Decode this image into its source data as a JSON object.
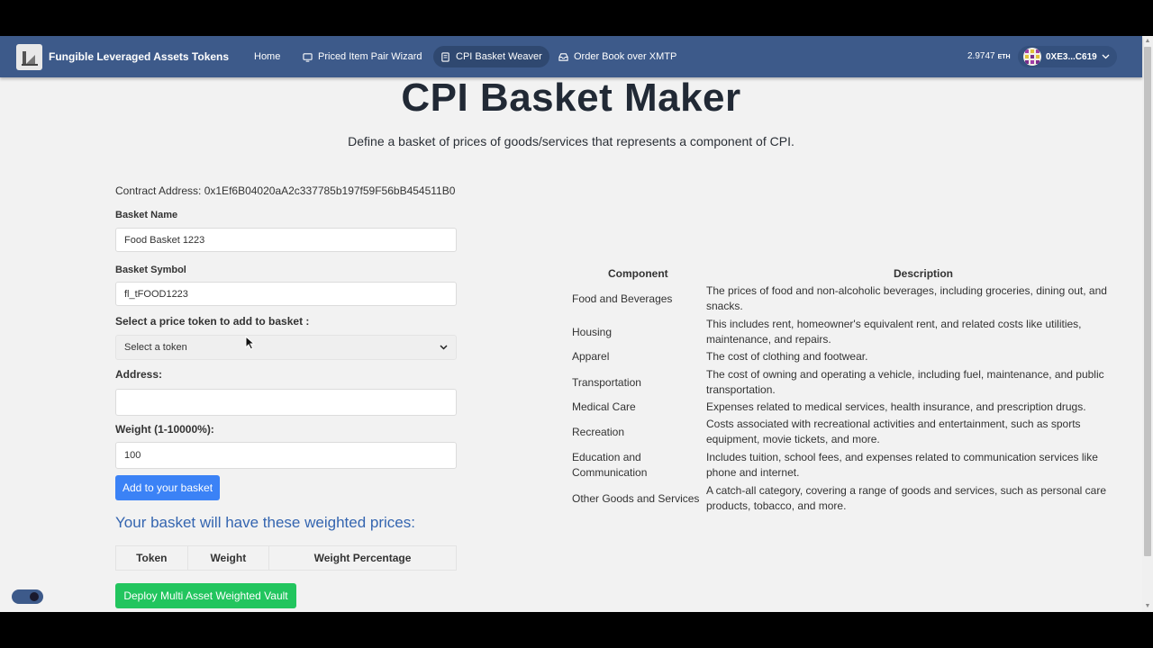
{
  "navbar": {
    "brand": "Fungible Leveraged Assets Tokens",
    "items": [
      {
        "label": "Home",
        "icon": "none"
      },
      {
        "label": "Priced Item Pair Wizard",
        "icon": "wizard-icon"
      },
      {
        "label": "CPI Basket Weaver",
        "icon": "document-icon",
        "active": true
      },
      {
        "label": "Order Book over XMTP",
        "icon": "inbox-icon"
      }
    ],
    "balance": "2.9747",
    "balance_unit": "ETH",
    "account": "0XE3...C619"
  },
  "page": {
    "title": "CPI Basket Maker",
    "subtitle": "Define a basket of prices of goods/services that represents a component of CPI.",
    "contract": "Contract Address: 0x1Ef6B04020aA2c337785b197f59F56bB454511B0"
  },
  "form": {
    "basket_name_label": "Basket Name",
    "basket_name_value": "Food Basket 1223",
    "basket_symbol_label": "Basket Symbol",
    "basket_symbol_value": "fl_tFOOD1223",
    "token_select_label": "Select a price token to add to basket :",
    "token_select_value": "Select a token",
    "address_label": "Address:",
    "address_value": "",
    "weight_label": "Weight (1-10000%):",
    "weight_value": "100",
    "add_button": "Add to your basket",
    "basket_heading": "Your basket will have these weighted prices:",
    "table_headers": [
      "Token",
      "Weight",
      "Weight Percentage"
    ],
    "deploy_button": "Deploy Multi Asset Weighted Vault"
  },
  "cpi": {
    "headers": {
      "component": "Component",
      "description": "Description"
    },
    "rows": [
      {
        "component": "Food and Beverages",
        "description": "The prices of food and non-alcoholic beverages, including groceries, dining out, and snacks."
      },
      {
        "component": "Housing",
        "description": "This includes rent, homeowner's equivalent rent, and related costs like utilities, maintenance, and repairs."
      },
      {
        "component": "Apparel",
        "description": "The cost of clothing and footwear."
      },
      {
        "component": "Transportation",
        "description": "The cost of owning and operating a vehicle, including fuel, maintenance, and public transportation."
      },
      {
        "component": "Medical Care",
        "description": "Expenses related to medical services, health insurance, and prescription drugs."
      },
      {
        "component": "Recreation",
        "description": "Costs associated with recreational activities and entertainment, such as sports equipment, movie tickets, and more."
      },
      {
        "component": "Education and Communication",
        "description": "Includes tuition, school fees, and expenses related to communication services like phone and internet."
      },
      {
        "component": "Other Goods and Services",
        "description": "A catch-all category, covering a range of goods and services, such as personal care products, tobacco, and more."
      }
    ]
  },
  "colors": {
    "navbar": "#3d5a8a",
    "add_button": "#3b82f6",
    "deploy_button": "#22c55e",
    "heading_blue": "#3465b0"
  }
}
